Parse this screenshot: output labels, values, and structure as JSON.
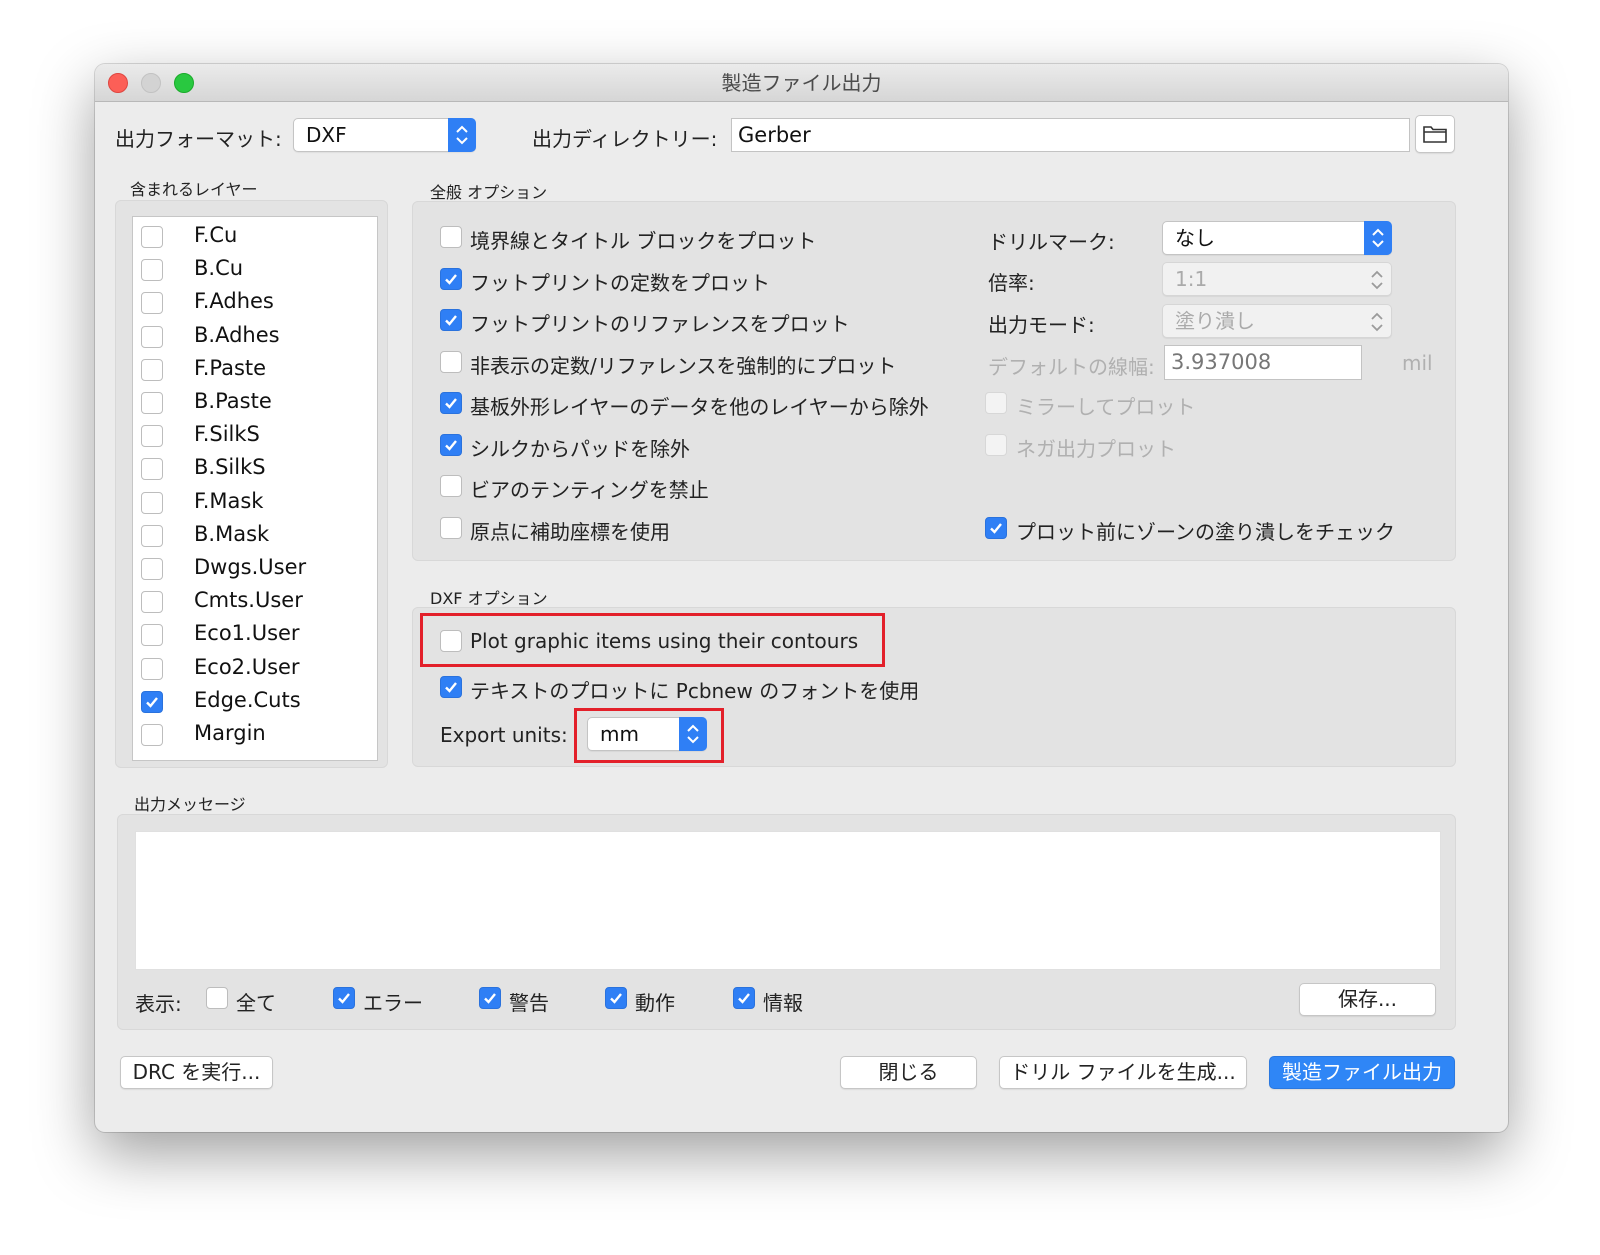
{
  "window": {
    "title": "製造ファイル出力"
  },
  "top": {
    "format_label": "出力フォーマット:",
    "format_value": "DXF",
    "dir_label": "出力ディレクトリー:",
    "dir_value": "Gerber"
  },
  "layers": {
    "group_label": "含まれるレイヤー",
    "items": [
      {
        "name": "F.Cu",
        "checked": false
      },
      {
        "name": "B.Cu",
        "checked": false
      },
      {
        "name": "F.Adhes",
        "checked": false
      },
      {
        "name": "B.Adhes",
        "checked": false
      },
      {
        "name": "F.Paste",
        "checked": false
      },
      {
        "name": "B.Paste",
        "checked": false
      },
      {
        "name": "F.SilkS",
        "checked": false
      },
      {
        "name": "B.SilkS",
        "checked": false
      },
      {
        "name": "F.Mask",
        "checked": false
      },
      {
        "name": "B.Mask",
        "checked": false
      },
      {
        "name": "Dwgs.User",
        "checked": false
      },
      {
        "name": "Cmts.User",
        "checked": false
      },
      {
        "name": "Eco1.User",
        "checked": false
      },
      {
        "name": "Eco2.User",
        "checked": false
      },
      {
        "name": "Edge.Cuts",
        "checked": true
      },
      {
        "name": "Margin",
        "checked": false
      }
    ]
  },
  "general": {
    "group_label": "全般 オプション",
    "options": [
      {
        "label": "境界線とタイトル ブロックをプロット",
        "checked": false
      },
      {
        "label": "フットプリントの定数をプロット",
        "checked": true
      },
      {
        "label": "フットプリントのリファレンスをプロット",
        "checked": true
      },
      {
        "label": "非表示の定数/リファレンスを強制的にプロット",
        "checked": false
      },
      {
        "label": "基板外形レイヤーのデータを他のレイヤーから除外",
        "checked": true
      },
      {
        "label": "シルクからパッドを除外",
        "checked": true
      },
      {
        "label": "ビアのテンティングを禁止",
        "checked": false
      },
      {
        "label": "原点に補助座標を使用",
        "checked": false
      }
    ],
    "drill_label": "ドリルマーク:",
    "drill_value": "なし",
    "scale_label": "倍率:",
    "scale_value": "1:1",
    "mode_label": "出力モード:",
    "mode_value": "塗り潰し",
    "linewidth_label": "デフォルトの線幅:",
    "linewidth_value": "3.937008",
    "linewidth_unit": "mil",
    "mirror_label": "ミラーしてプロット",
    "negative_label": "ネガ出力プロット",
    "zone_check_label": "プロット前にゾーンの塗り潰しをチェック"
  },
  "dxf": {
    "group_label": "DXF オプション",
    "contours_label": "Plot graphic items using their contours",
    "font_label": "テキストのプロットに Pcbnew のフォントを使用",
    "units_label": "Export units:",
    "units_value": "mm"
  },
  "messages": {
    "group_label": "出力メッセージ",
    "show_label": "表示:",
    "filters": [
      {
        "label": "全て",
        "checked": false
      },
      {
        "label": "エラー",
        "checked": true
      },
      {
        "label": "警告",
        "checked": true
      },
      {
        "label": "動作",
        "checked": true
      },
      {
        "label": "情報",
        "checked": true
      }
    ],
    "save_label": "保存..."
  },
  "buttons": {
    "drc_label": "DRC を実行...",
    "close_label": "閉じる",
    "drill_label": "ドリル ファイルを生成...",
    "plot_label": "製造ファイル出力"
  },
  "colors": {
    "accent": "#2f7ff5",
    "highlight": "#e3202a"
  }
}
